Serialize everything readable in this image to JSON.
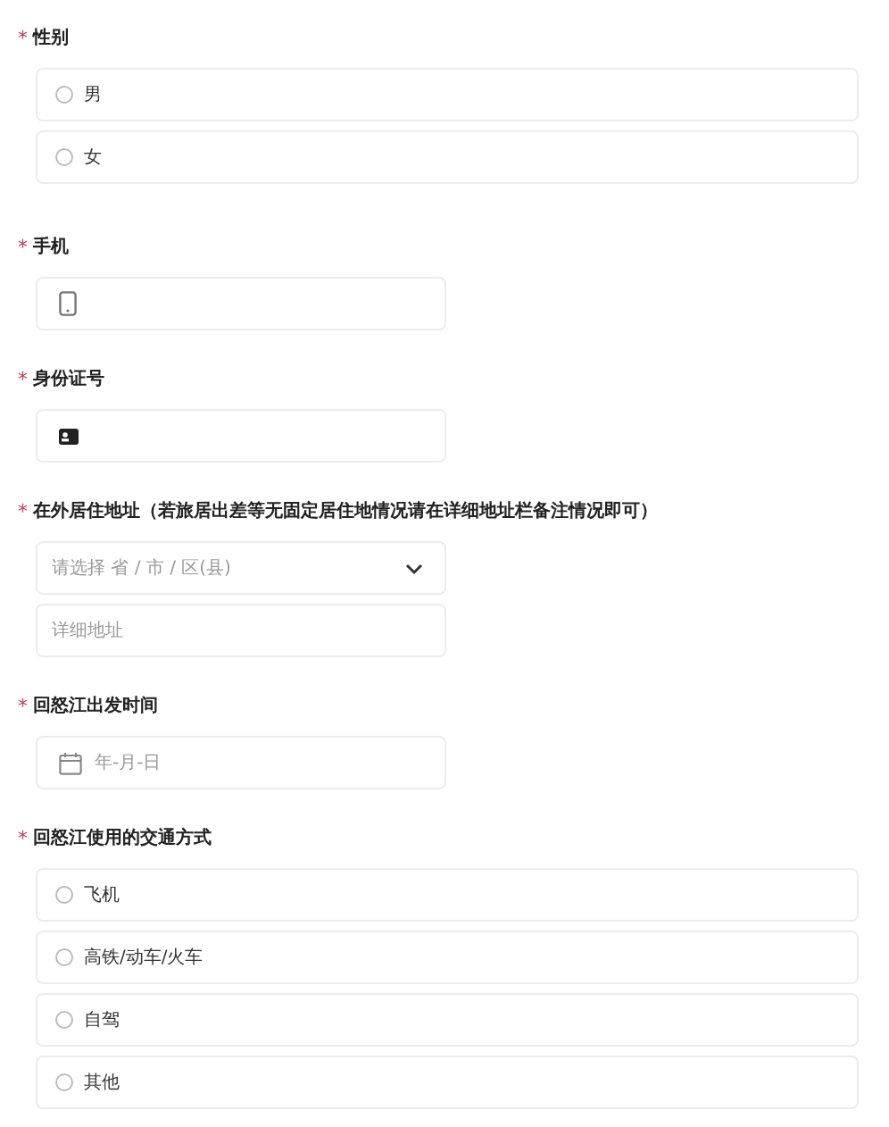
{
  "questions": [
    {
      "mark": "*",
      "label": "性别",
      "controls": [
        {
          "kind": "radio",
          "label": "男",
          "selected": false
        },
        {
          "kind": "radio",
          "label": "女",
          "selected": false
        }
      ]
    },
    {
      "mark": "*",
      "label": "手机",
      "controls": [
        {
          "kind": "phone"
        }
      ]
    },
    {
      "mark": "*",
      "label": "身份证号",
      "controls": [
        {
          "kind": "id"
        }
      ]
    },
    {
      "mark": "*",
      "label": "在外居住地址（若旅居出差等无固定居住地情况请在详细地址栏备注情况即可）",
      "controls": [
        {
          "kind": "select",
          "placeholder": "请选择 省 / 市 / 区(县)"
        },
        {
          "kind": "text",
          "placeholder": "详细地址"
        }
      ]
    },
    {
      "mark": "*",
      "label": "回怒江出发时间",
      "controls": [
        {
          "kind": "date",
          "placeholder": "年-月-日"
        }
      ]
    },
    {
      "mark": "*",
      "label": "回怒江使用的交通方式",
      "controls": [
        {
          "kind": "radio",
          "label": "飞机",
          "selected": false
        },
        {
          "kind": "radio",
          "label": "高铁/动车/火车",
          "selected": false
        },
        {
          "kind": "radio",
          "label": "自驾",
          "selected": false
        },
        {
          "kind": "radio",
          "label": "其他",
          "selected": false
        }
      ]
    }
  ]
}
